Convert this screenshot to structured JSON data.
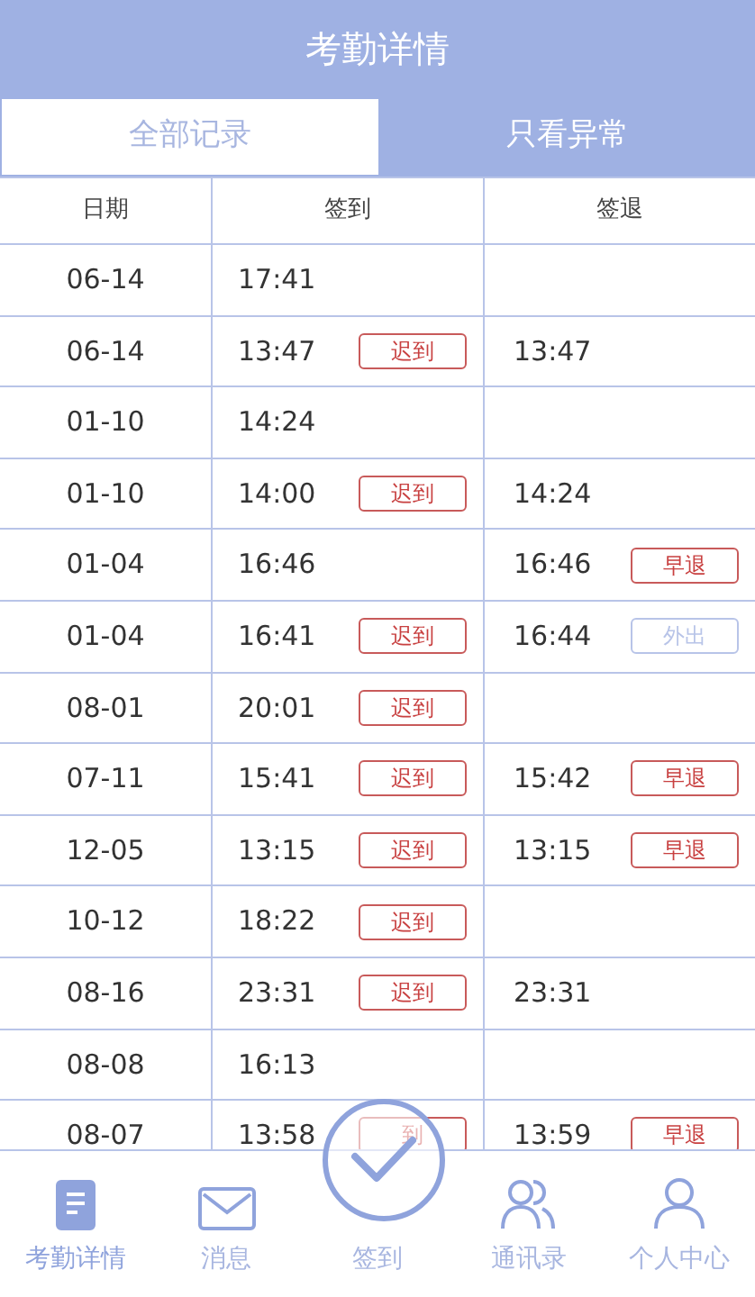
{
  "header": {
    "title": "考勤详情"
  },
  "tabs": [
    {
      "label": "全部记录",
      "selected": false
    },
    {
      "label": "只看异常",
      "selected": true
    }
  ],
  "table": {
    "columns": [
      "日期",
      "签到",
      "签退"
    ],
    "rows": [
      {
        "date": "06-14",
        "in": {
          "time": "17:41"
        },
        "out": {}
      },
      {
        "date": "06-14",
        "in": {
          "time": "13:47",
          "badge": {
            "text": "迟到",
            "kind": "alert"
          }
        },
        "out": {
          "time": "13:47"
        }
      },
      {
        "date": "01-10",
        "in": {
          "time": "14:24"
        },
        "out": {}
      },
      {
        "date": "01-10",
        "in": {
          "time": "14:00",
          "badge": {
            "text": "迟到",
            "kind": "alert"
          }
        },
        "out": {
          "time": "14:24"
        }
      },
      {
        "date": "01-04",
        "in": {
          "time": "16:46"
        },
        "out": {
          "time": "16:46",
          "badge": {
            "text": "早退",
            "kind": "alert"
          }
        }
      },
      {
        "date": "01-04",
        "in": {
          "time": "16:41",
          "badge": {
            "text": "迟到",
            "kind": "alert"
          }
        },
        "out": {
          "time": "16:44",
          "badge": {
            "text": "外出",
            "kind": "info"
          }
        }
      },
      {
        "date": "08-01",
        "in": {
          "time": "20:01",
          "badge": {
            "text": "迟到",
            "kind": "alert"
          }
        },
        "out": {}
      },
      {
        "date": "07-11",
        "in": {
          "time": "15:41",
          "badge": {
            "text": "迟到",
            "kind": "alert"
          }
        },
        "out": {
          "time": "15:42",
          "badge": {
            "text": "早退",
            "kind": "alert"
          }
        }
      },
      {
        "date": "12-05",
        "in": {
          "time": "13:15",
          "badge": {
            "text": "迟到",
            "kind": "alert"
          }
        },
        "out": {
          "time": "13:15",
          "badge": {
            "text": "早退",
            "kind": "alert"
          }
        }
      },
      {
        "date": "10-12",
        "in": {
          "time": "18:22",
          "badge": {
            "text": "迟到",
            "kind": "alert"
          }
        },
        "out": {}
      },
      {
        "date": "08-16",
        "in": {
          "time": "23:31",
          "badge": {
            "text": "迟到",
            "kind": "alert"
          }
        },
        "out": {
          "time": "23:31"
        }
      },
      {
        "date": "08-08",
        "in": {
          "time": "16:13"
        },
        "out": {}
      },
      {
        "date": "08-07",
        "in": {
          "time": "13:58",
          "badge": {
            "text": "到",
            "kind": "alert"
          }
        },
        "out": {
          "time": "13:59",
          "badge": {
            "text": "早退",
            "kind": "alert"
          }
        }
      }
    ]
  },
  "nav": [
    {
      "label": "考勤详情",
      "selected": true
    },
    {
      "label": "消息",
      "selected": false
    },
    {
      "label": "签到",
      "selected": false
    },
    {
      "label": "通讯录",
      "selected": false
    },
    {
      "label": "个人中心",
      "selected": false
    }
  ]
}
